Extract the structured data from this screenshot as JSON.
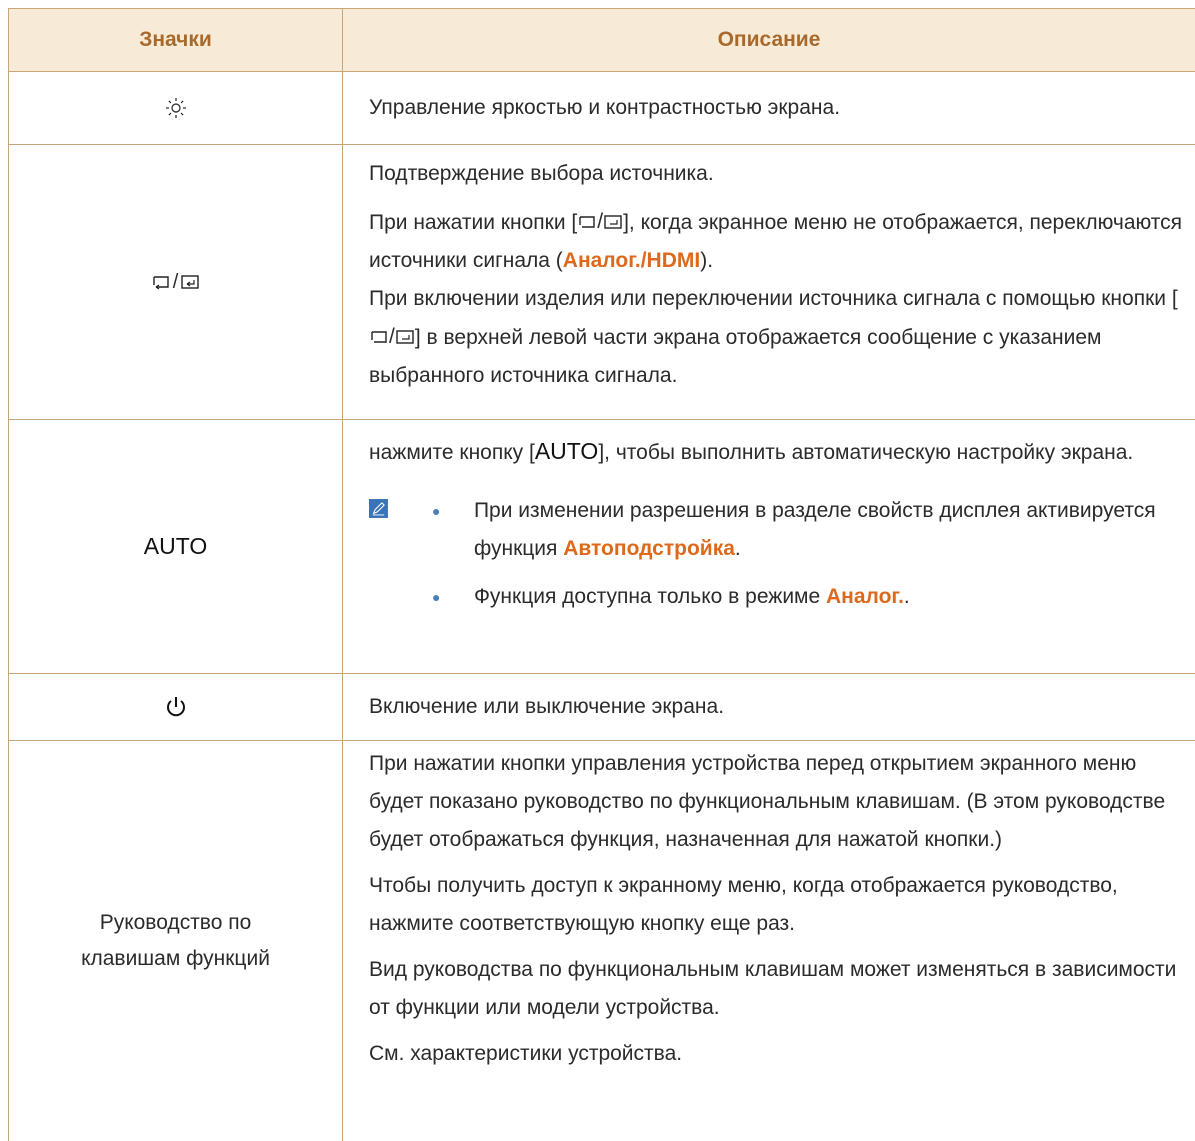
{
  "header": {
    "col1": "Значки",
    "col2": "Описание"
  },
  "rows": {
    "brightness": {
      "icon": "sun-icon",
      "text": "Управление яркостью и контрастностью экрана."
    },
    "source": {
      "icon": "source-enter-icon",
      "icon_label": "/",
      "p1": "Подтверждение выбора источника.",
      "p2a": "При нажатии кнопки [",
      "p2b": "], когда экранное меню не отображается, переключаются источники сигнала (",
      "p2_analog": "Аналог.",
      "p2_slash": "/",
      "p2_hdmi": "HDMI",
      "p2c": ").",
      "p3a": "При включении изделия или переключении источника сигнала с помощью кнопки [",
      "p3b": "] в верхней левой части экрана отображается сообщение с указанием выбранного источника сигнала."
    },
    "auto": {
      "label": "AUTO",
      "p1a": "нажмите кнопку [",
      "p1_key": "AUTO",
      "p1b": "], чтобы выполнить автоматическую настройку экрана.",
      "note_icon": "note-pencil-icon",
      "b1a": "При изменении разрешения в разделе свойств дисплея активируется функция ",
      "b1_hl": "Автоподстройка",
      "b1b": ".",
      "b2a": "Функция доступна только в режиме ",
      "b2_hl": "Аналог.",
      "b2b": "."
    },
    "power": {
      "icon": "power-icon",
      "text": "Включение или выключение экрана."
    },
    "guide": {
      "label": "Руководство по клавишам функций",
      "p1": "При нажатии кнопки управления устройства перед открытием экранного меню будет показано руководство по функциональным клавишам. (В этом руководстве будет отображаться функция, назначенная для нажатой кнопки.)",
      "p2": "Чтобы получить доступ к экранному меню, когда отображается руководство, нажмите соответствующую кнопку еще раз.",
      "p3": "Вид руководства по функциональным клавишам может изменяться в зависимости от функции или модели устройства.",
      "p4": "См. характеристики устройства."
    }
  },
  "colors": {
    "header_bg": "#f7ebd7",
    "header_text": "#a86a2c",
    "border": "#c8a577",
    "highlight": "#dd6a1c"
  }
}
